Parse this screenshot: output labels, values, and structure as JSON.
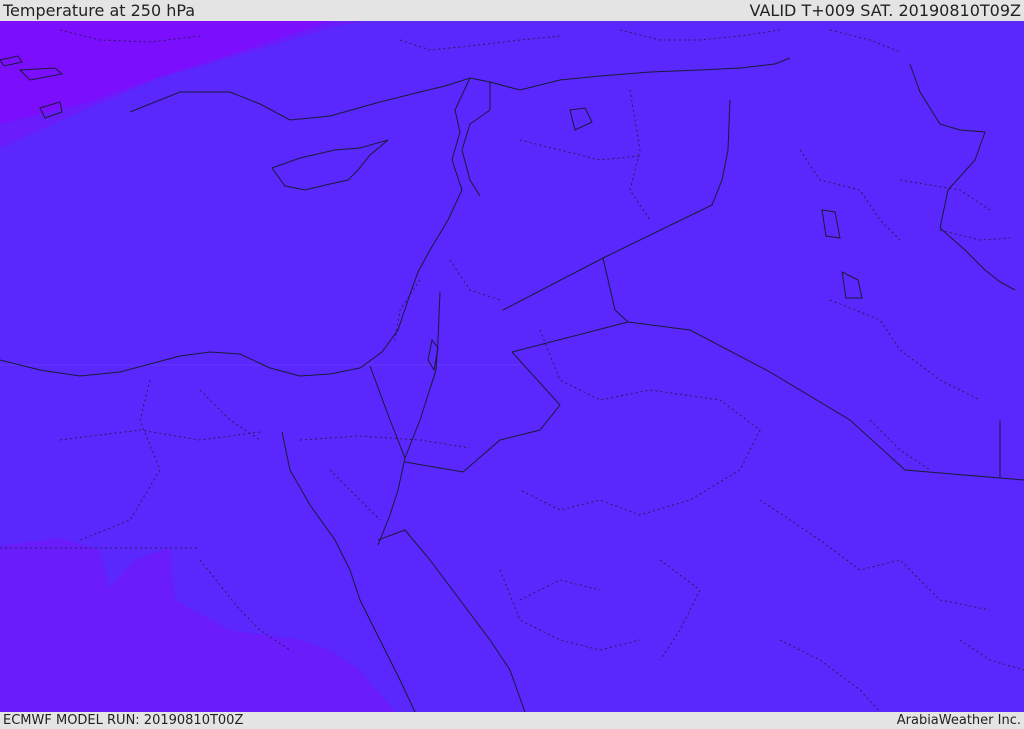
{
  "header": {
    "title": "Temperature at 250 hPa",
    "valid": "VALID T+009 SAT. 20190810T09Z"
  },
  "footer": {
    "model_run": "ECMWF MODEL RUN: 20190810T00Z",
    "credit": "ArabiaWeather Inc."
  },
  "map": {
    "field": "Temperature at 250 hPa",
    "region": "Eastern Mediterranean / Middle East",
    "colors": {
      "main_fill": "#5a27fc",
      "cold_band": "#6a1cfb",
      "coldest_corner": "#7e0cfb",
      "border_line": "#1a1a3a"
    }
  }
}
